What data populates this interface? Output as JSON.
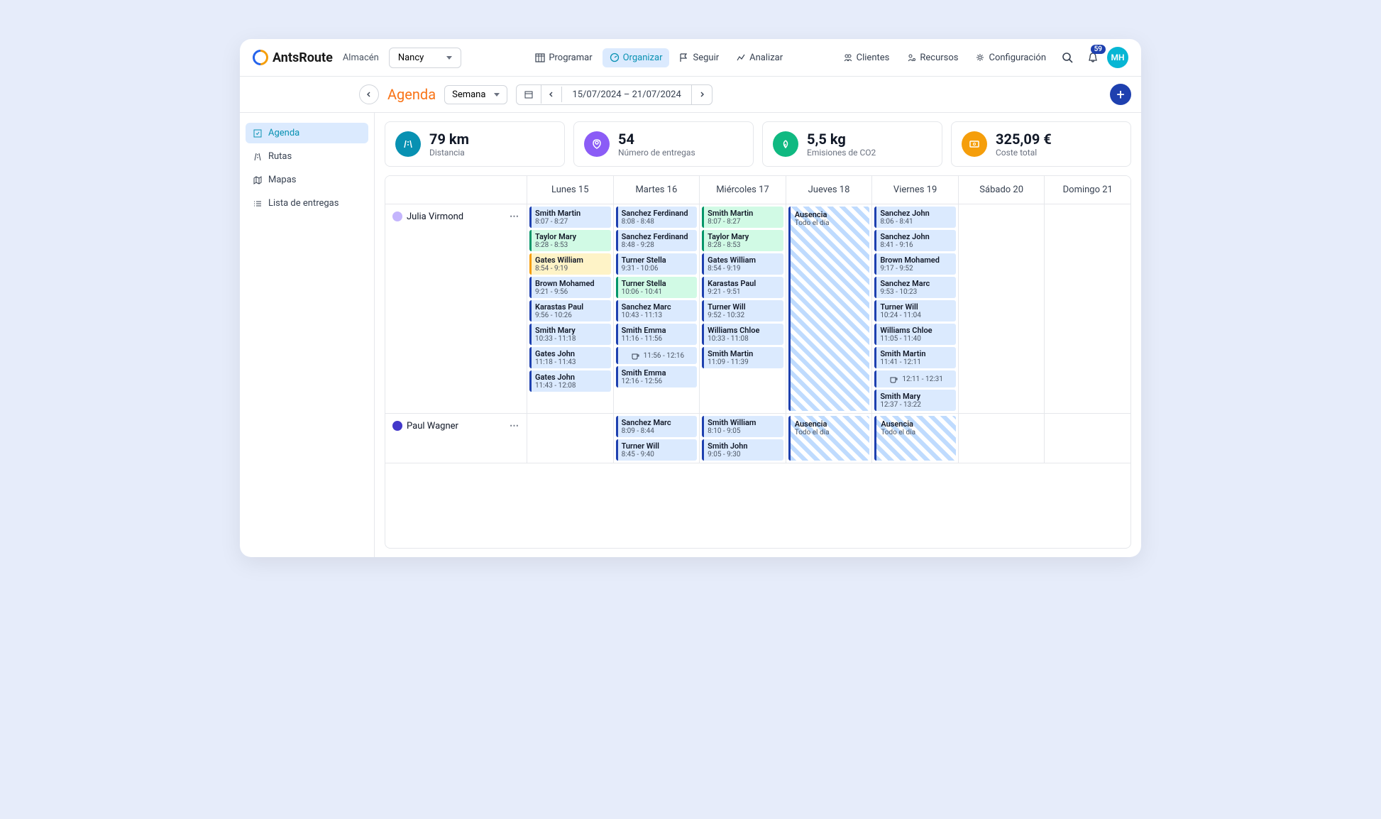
{
  "brand": "AntsRoute",
  "warehouse_label": "Almacén",
  "warehouse_value": "Nancy",
  "nav": {
    "programar": "Programar",
    "organizar": "Organizar",
    "seguir": "Seguir",
    "analizar": "Analizar",
    "clientes": "Clientes",
    "recursos": "Recursos",
    "configuracion": "Configuración"
  },
  "notification_count": "59",
  "avatar_initials": "MH",
  "subbar": {
    "title": "Agenda",
    "view": "Semana",
    "date_range": "15/07/2024 – 21/07/2024"
  },
  "sidebar": {
    "agenda": "Agenda",
    "rutas": "Rutas",
    "mapas": "Mapas",
    "entregas": "Lista de entregas"
  },
  "stats": [
    {
      "value": "79 km",
      "label": "Distancia",
      "color": "#0891b2"
    },
    {
      "value": "54",
      "label": "Número de entregas",
      "color": "#8b5cf6"
    },
    {
      "value": "5,5 kg",
      "label": "Emisiones de CO2",
      "color": "#10b981"
    },
    {
      "value": "325,09 €",
      "label": "Coste total",
      "color": "#f59e0b"
    }
  ],
  "days": [
    "Lunes 15",
    "Martes 16",
    "Miércoles 17",
    "Jueves 18",
    "Viernes 19",
    "Sábado 20",
    "Domingo 21"
  ],
  "absence_label": "Ausencia",
  "absence_sub": "Todo el día",
  "drivers": [
    {
      "name": "Julia Virmond",
      "color": "#c4b5fd",
      "schedule": [
        [
          {
            "name": "Smith Martin",
            "time": "8:07 - 8:27",
            "c": "blue"
          },
          {
            "name": "Taylor Mary",
            "time": "8:28 - 8:53",
            "c": "green"
          },
          {
            "name": "Gates William",
            "time": "8:54 - 9:19",
            "c": "yellow"
          },
          {
            "name": "Brown Mohamed",
            "time": "9:21 - 9:56",
            "c": "blue"
          },
          {
            "name": "Karastas Paul",
            "time": "9:56 - 10:26",
            "c": "blue"
          },
          {
            "name": "Smith Mary",
            "time": "10:33 - 11:18",
            "c": "blue"
          },
          {
            "name": "Gates John",
            "time": "11:18 - 11:43",
            "c": "blue"
          },
          {
            "name": "Gates John",
            "time": "11:43 - 12:08",
            "c": "blue"
          }
        ],
        [
          {
            "name": "Sanchez Ferdinand",
            "time": "8:08 - 8:48",
            "c": "blue"
          },
          {
            "name": "Sanchez Ferdinand",
            "time": "8:48 - 9:28",
            "c": "blue"
          },
          {
            "name": "Turner Stella",
            "time": "9:31 - 10:06",
            "c": "blue"
          },
          {
            "name": "Turner Stella",
            "time": "10:06 - 10:41",
            "c": "green"
          },
          {
            "name": "Sanchez Marc",
            "time": "10:43 - 11:13",
            "c": "blue"
          },
          {
            "name": "Smith Emma",
            "time": "11:16 - 11:56",
            "c": "blue"
          },
          {
            "break": true,
            "time": "11:56 - 12:16"
          },
          {
            "name": "Smith Emma",
            "time": "12:16 - 12:56",
            "c": "blue"
          }
        ],
        [
          {
            "name": "Smith Martin",
            "time": "8:07 - 8:27",
            "c": "green"
          },
          {
            "name": "Taylor Mary",
            "time": "8:28 - 8:53",
            "c": "green"
          },
          {
            "name": "Gates William",
            "time": "8:54 - 9:19",
            "c": "blue"
          },
          {
            "name": "Karastas Paul",
            "time": "9:21 - 9:51",
            "c": "blue"
          },
          {
            "name": "Turner Will",
            "time": "9:52 - 10:32",
            "c": "blue"
          },
          {
            "name": "Williams Chloe",
            "time": "10:33 - 11:08",
            "c": "blue"
          },
          {
            "name": "Smith Martin",
            "time": "11:09 - 11:39",
            "c": "blue"
          }
        ],
        [
          {
            "absence": true
          }
        ],
        [
          {
            "name": "Sanchez John",
            "time": "8:06 - 8:41",
            "c": "blue"
          },
          {
            "name": "Sanchez John",
            "time": "8:41 - 9:16",
            "c": "blue"
          },
          {
            "name": "Brown Mohamed",
            "time": "9:17 - 9:52",
            "c": "blue"
          },
          {
            "name": "Sanchez Marc",
            "time": "9:53 - 10:23",
            "c": "blue"
          },
          {
            "name": "Turner Will",
            "time": "10:24 - 11:04",
            "c": "blue"
          },
          {
            "name": "Williams Chloe",
            "time": "11:05 - 11:40",
            "c": "blue"
          },
          {
            "name": "Smith Martin",
            "time": "11:41 - 12:11",
            "c": "blue"
          },
          {
            "break": true,
            "time": "12:11 - 12:31"
          },
          {
            "name": "Smith Mary",
            "time": "12:37 - 13:22",
            "c": "blue"
          }
        ],
        [],
        []
      ]
    },
    {
      "name": "Paul Wagner",
      "color": "#4338ca",
      "schedule": [
        [],
        [
          {
            "name": "Sanchez Marc",
            "time": "8:09 - 8:44",
            "c": "blue"
          },
          {
            "name": "Turner Will",
            "time": "8:45 - 9:40",
            "c": "blue"
          }
        ],
        [
          {
            "name": "Smith William",
            "time": "8:10 - 9:05",
            "c": "blue"
          },
          {
            "name": "Smith John",
            "time": "9:05 - 9:30",
            "c": "blue"
          }
        ],
        [
          {
            "absence": true
          }
        ],
        [
          {
            "absence": true
          }
        ],
        [],
        []
      ]
    }
  ]
}
